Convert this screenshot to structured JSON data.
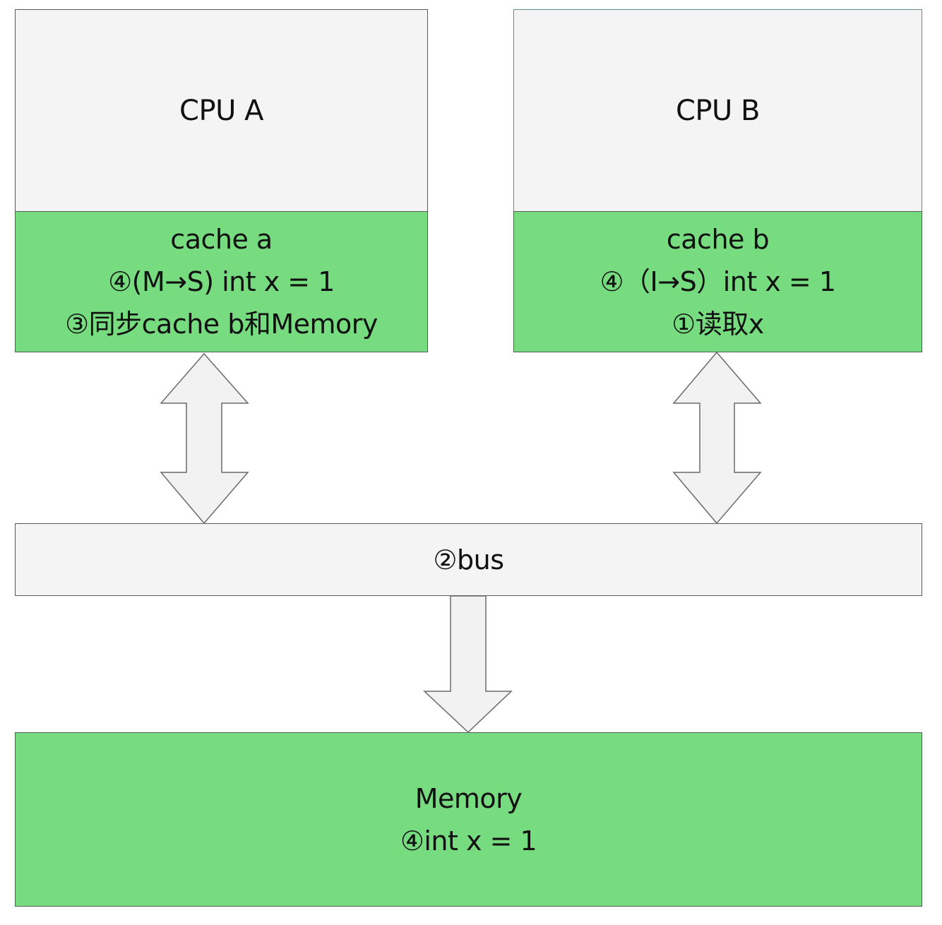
{
  "cpu_a": {
    "title": "CPU A"
  },
  "cache_a": {
    "title": "cache a",
    "lines": [
      "④(M→S) int x = 1",
      "③同步cache b和Memory"
    ]
  },
  "cpu_b": {
    "title": "CPU B"
  },
  "cache_b": {
    "title": "cache b",
    "lines": [
      "④（I→S）int x = 1",
      "①读取x"
    ]
  },
  "bus": {
    "label": "②bus"
  },
  "memory": {
    "title": "Memory",
    "lines": [
      "④int x = 1"
    ]
  },
  "colors": {
    "cache_fill": "#77dc80",
    "cpu_fill": "#f4f4f4",
    "arrow_fill": "#f2f2f2",
    "stroke": "#5a5a5a"
  }
}
